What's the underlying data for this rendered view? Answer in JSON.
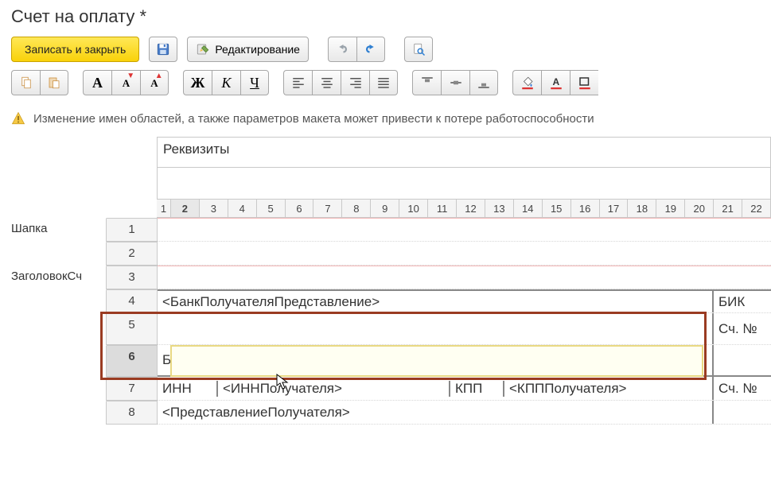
{
  "title": "Счет на оплату *",
  "toolbar": {
    "save_close": "Записать и закрыть",
    "edit_mode": "Редактирование"
  },
  "warning": "Изменение имен областей, а также параметров макета может привести к потере работоспособности",
  "section_label": "Реквизиты",
  "row_area_names": [
    "Шапка",
    "",
    "ЗаголовокСч",
    "",
    "",
    "",
    "",
    ""
  ],
  "row_numbers": [
    "1",
    "2",
    "3",
    "4",
    "5",
    "6",
    "7",
    "8"
  ],
  "col_numbers": [
    "1",
    "2",
    "3",
    "4",
    "5",
    "6",
    "7",
    "8",
    "9",
    "10",
    "11",
    "12",
    "13",
    "14",
    "15",
    "16",
    "17",
    "18",
    "19",
    "20",
    "21",
    "22"
  ],
  "cells": {
    "r4_main": "<БанкПолучателяПредставление>",
    "r4_right": "БИК",
    "r5_right": "Сч. №",
    "r6_main": "Банк получателя",
    "r7_inn_label": "ИНН",
    "r7_inn_val": "<ИННПолучателя>",
    "r7_kpp_label": "КПП",
    "r7_kpp_val": "<КПППолучателя>",
    "r7_right": "Сч. №",
    "r8_main": "<ПредставлениеПолучателя>"
  }
}
